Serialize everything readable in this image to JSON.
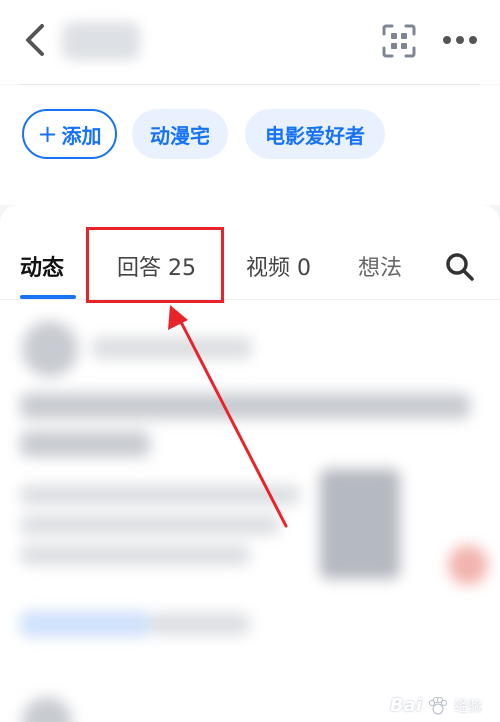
{
  "header": {
    "back_icon": "chevron-left-icon",
    "scan_icon": "qr-scan-icon",
    "more_icon": "more-dots-icon"
  },
  "tags": {
    "add_plus": "+",
    "add_label": "添加",
    "items": [
      "动漫宅",
      "电影爱好者"
    ]
  },
  "tabs": {
    "items": [
      {
        "label": "动态",
        "active": true
      },
      {
        "label": "回答 25",
        "active": false
      },
      {
        "label": "视频 0",
        "active": false
      },
      {
        "label": "想法",
        "active": false
      }
    ],
    "search_icon": "search-icon"
  },
  "annotation": {
    "highlight_color": "#e8242a",
    "arrow_color": "#e8242a"
  },
  "colors": {
    "accent": "#1772f6",
    "tag_bg": "#e8f1fd"
  },
  "watermark": {
    "brand": "Bai",
    "sub": "经验"
  }
}
